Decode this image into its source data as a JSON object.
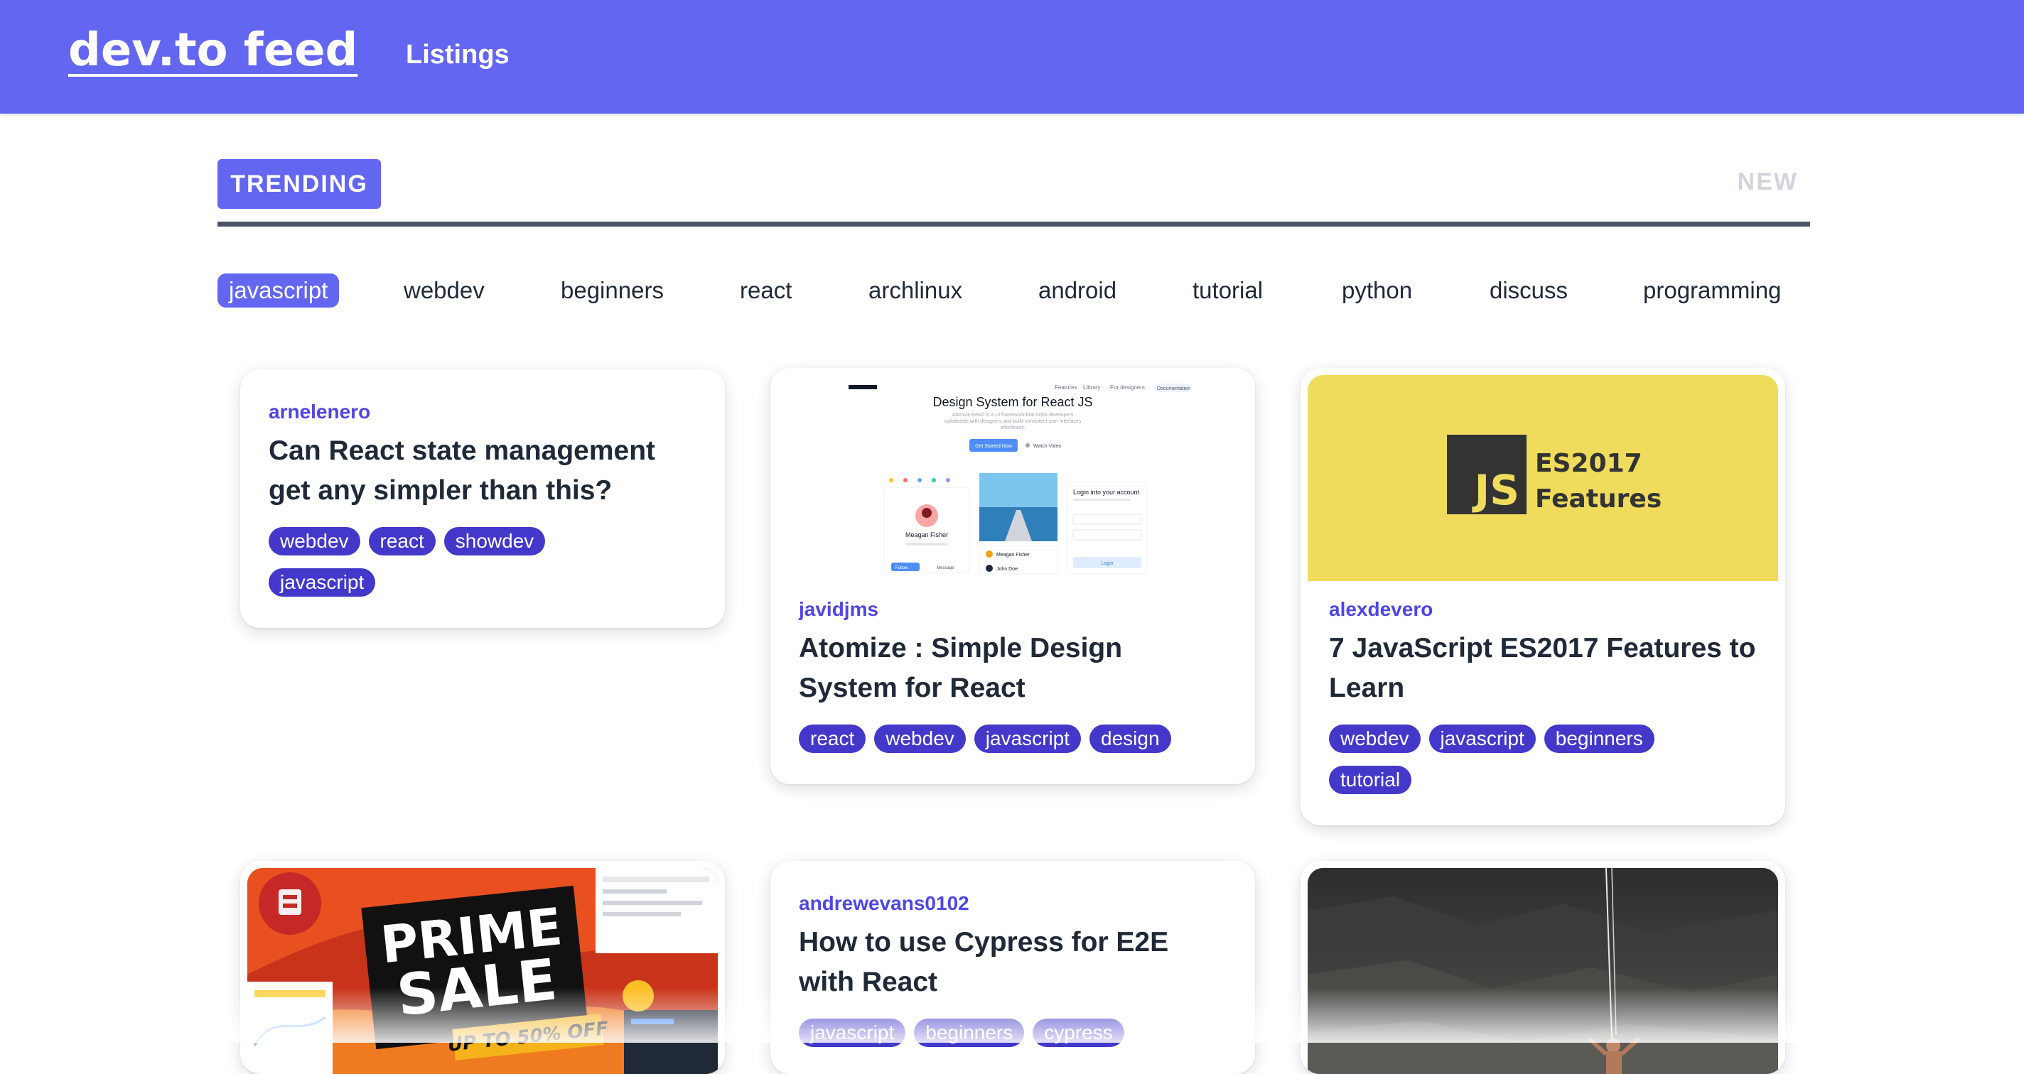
{
  "header": {
    "brand": "dev.to feed",
    "listings_label": "Listings"
  },
  "tabs": {
    "trending": "TRENDING",
    "new": "NEW"
  },
  "filters": [
    "javascript",
    "webdev",
    "beginners",
    "react",
    "archlinux",
    "android",
    "tutorial",
    "python",
    "discuss",
    "programming"
  ],
  "active_filter": "javascript",
  "cards": [
    {
      "author": "arnelenero",
      "title": "Can React state management get any simpler than this?",
      "tags": [
        "webdev",
        "react",
        "showdev",
        "javascript"
      ],
      "thumbnail": null
    },
    {
      "author": "javidjms",
      "title": "Atomize : Simple Design System for React",
      "tags": [
        "react",
        "webdev",
        "javascript",
        "design"
      ],
      "thumbnail": {
        "kind": "design-system-screenshot",
        "headline": "Design System for React JS",
        "blurb": "Atomize React is a UI framework that helps developers collaborate with designers and build consistent user interfaces effortlessly.",
        "primary_cta": "Get Started Now",
        "secondary_cta": "Watch Video",
        "profile_name": "Meagan Fisher",
        "login_heading": "Login into your account",
        "login_button": "Login",
        "nav": [
          "Features",
          "Library",
          "For designers",
          "Documentation"
        ],
        "mini_names": [
          "Meagan Fisher",
          "John Doe"
        ],
        "mini_buttons": [
          "Follow",
          "Message"
        ]
      }
    },
    {
      "author": "alexdevero",
      "title": "7 JavaScript ES2017 Features to Learn",
      "tags": [
        "webdev",
        "javascript",
        "beginners",
        "tutorial"
      ],
      "thumbnail": {
        "kind": "js-banner",
        "badge": "JS",
        "line1": "ES2017",
        "line2": "Features",
        "bg_color": "#efdc5c"
      }
    },
    {
      "author": null,
      "title": null,
      "tags": [],
      "thumbnail": {
        "kind": "sale-banner",
        "headline1": "PRIME",
        "headline2": "SALE",
        "subline": "UP TO 50% OFF"
      }
    },
    {
      "author": "andrewevans0102",
      "title": "How to use Cypress for E2E with React",
      "tags": [
        "javascript",
        "beginners",
        "cypress"
      ],
      "thumbnail": null
    },
    {
      "author": null,
      "title": null,
      "tags": [],
      "thumbnail": {
        "kind": "photo-climber"
      }
    }
  ],
  "colors": {
    "accent": "#6366f1",
    "tag_bg": "#4338ca",
    "author": "#4f46e5",
    "tab_rule": "#4b5563"
  }
}
